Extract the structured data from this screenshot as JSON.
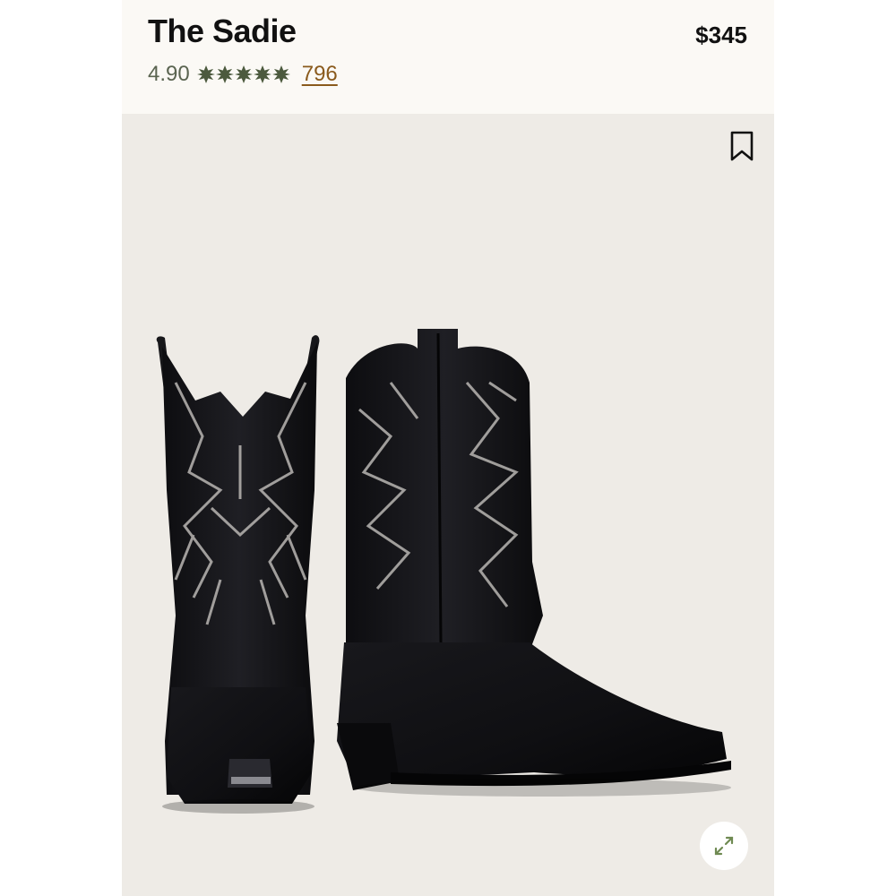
{
  "product": {
    "name": "The Sadie",
    "price": "$345"
  },
  "rating": {
    "value": "4.90",
    "stars": 5,
    "review_count": "796"
  },
  "colors": {
    "header_bg": "#fbf9f5",
    "image_bg": "#eeebe6",
    "rating_text": "#5a6450",
    "star": "#4c5a3e",
    "review_link": "#8a5a1c",
    "expand_icon": "#6f8a52"
  },
  "icons": {
    "bookmark": "bookmark-icon",
    "expand": "expand-icon",
    "star": "star-icon"
  },
  "image": {
    "subject": "boots"
  }
}
